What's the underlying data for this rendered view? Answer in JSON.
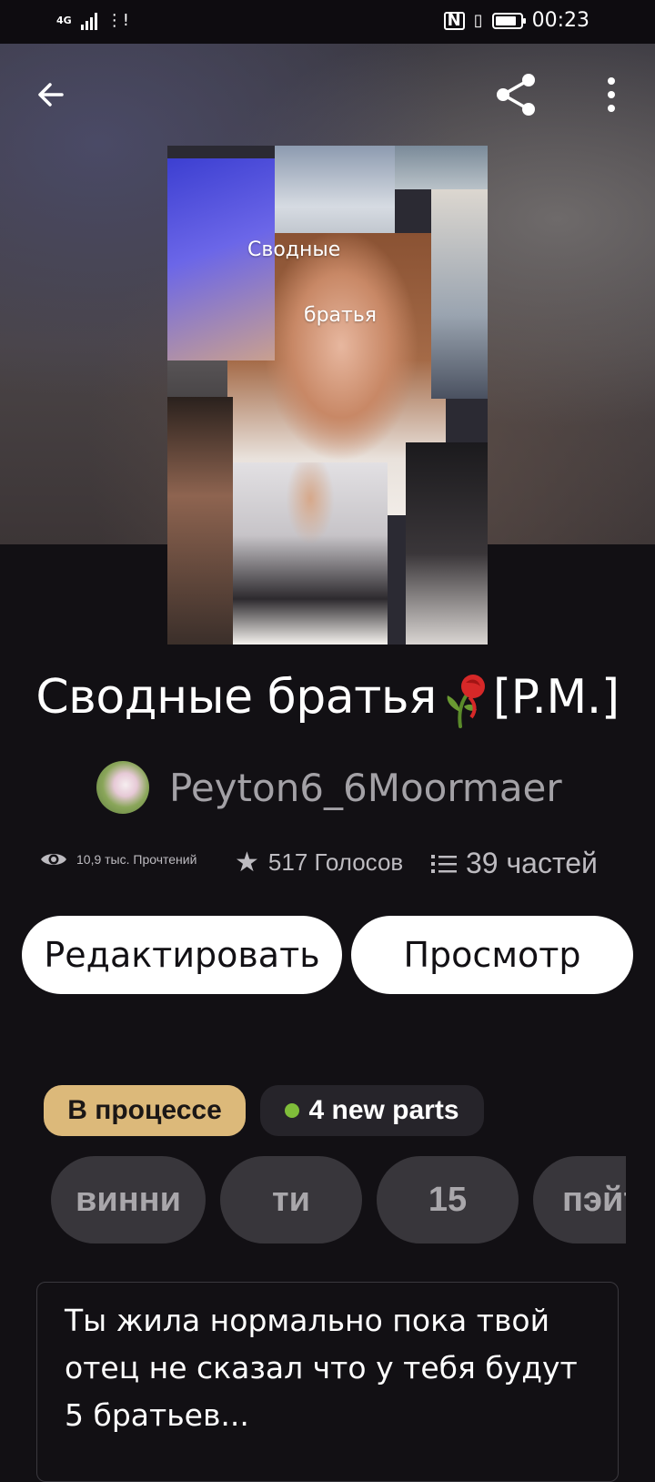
{
  "status_bar": {
    "network": "4G",
    "time": "00:23"
  },
  "header": {
    "back_icon": "arrow-left-icon",
    "share_icon": "share-icon",
    "more_icon": "more-vertical-icon"
  },
  "cover": {
    "title_line1": "Сводные",
    "title_line2": "братья"
  },
  "story": {
    "title_main": "Сводные братья",
    "title_suffix": "[P.M.]",
    "author": "Peyton6_6Moormaer"
  },
  "stats": {
    "reads": "10,9 тыс. Прочтений",
    "votes": "517 Голосов",
    "parts": "39 частей"
  },
  "actions": {
    "edit": "Редактировать",
    "view": "Просмотр"
  },
  "badges": {
    "status": "В процессе",
    "new_parts": "4 new parts"
  },
  "tags": [
    "винни",
    "ти",
    "15",
    "пэйтон"
  ],
  "description": "Ты жила нормально пока твой отец не сказал что у тебя будут 5 братьев...",
  "colors": {
    "background": "#121014",
    "status_badge": "#dcb97a",
    "new_dot": "#7fbd3a",
    "tag_bg": "#38363b"
  }
}
